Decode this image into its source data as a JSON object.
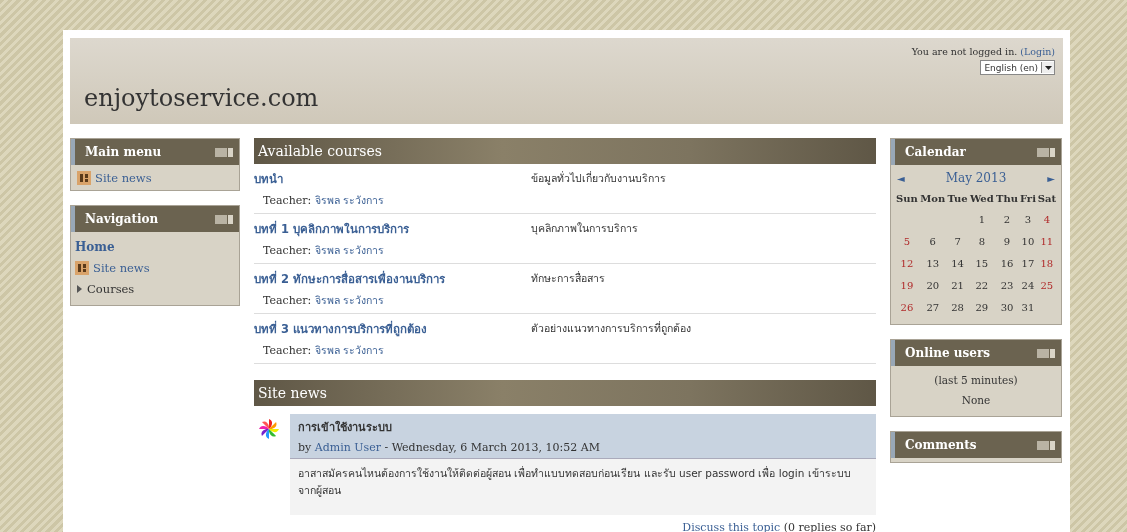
{
  "header": {
    "site_name": "enjoytoservice.com",
    "login_info": "You are not logged in.",
    "login_link": "(Login)",
    "language": "English (en)"
  },
  "main_menu": {
    "title": "Main menu",
    "items": [
      {
        "label": "Site news",
        "kind": "news"
      }
    ]
  },
  "navigation": {
    "title": "Navigation",
    "items": [
      {
        "label": "Home",
        "kind": "home"
      },
      {
        "label": "Site news",
        "kind": "news"
      },
      {
        "label": "Courses",
        "kind": "branch",
        "expanded": false
      }
    ]
  },
  "available_courses": {
    "title": "Available courses",
    "courses": [
      {
        "name": "บทนำ",
        "summary": "ข้อมูลทั่วไปเกี่ยวกับงานบริการ",
        "teacher_label": "Teacher:",
        "teacher": "จิรพล ระวังการ"
      },
      {
        "name": "บทที่ 1 บุคลิกภาพในการบริการ",
        "summary": "บุคลิกภาพในการบริการ",
        "teacher_label": "Teacher:",
        "teacher": "จิรพล ระวังการ"
      },
      {
        "name": "บทที่ 2 ทักษะการสื่อสารเพื่องานบริการ",
        "summary": "ทักษะการสื่อสาร",
        "teacher_label": "Teacher:",
        "teacher": "จิรพล ระวังการ"
      },
      {
        "name": "บทที่ 3 แนวทางการบริการที่ถูกต้อง",
        "summary": "ตัวอย่างแนวทางการบริการที่ถูกต้อง",
        "teacher_label": "Teacher:",
        "teacher": "จิรพล ระวังการ"
      }
    ]
  },
  "site_news": {
    "title": "Site news",
    "posts": [
      {
        "subject": "การเข้าใช้งานระบบ",
        "by": "by",
        "author": "Admin User",
        "date": "- Wednesday, 6 March 2013, 10:52 AM",
        "body": "อาสาสมัครคนไหนต้องการใช้งานให้ติดต่อผู้สอน เพื่อทำแบบทดสอบก่อนเรียน และรับ user password เพื่อ login เข้าระบบจากผู้สอน",
        "discuss_link": "Discuss this topic",
        "replies": "(0 replies so far)"
      }
    ]
  },
  "calendar": {
    "title": "Calendar",
    "prev": "◄",
    "month": "May 2013",
    "next": "►",
    "weekdays": [
      "Sun",
      "Mon",
      "Tue",
      "Wed",
      "Thu",
      "Fri",
      "Sat"
    ],
    "weeks": [
      [
        {
          "kind": "empty"
        },
        {
          "kind": "empty"
        },
        {
          "kind": "empty"
        },
        {
          "day": "1",
          "weekend": false
        },
        {
          "day": "2",
          "weekend": false
        },
        {
          "day": "3",
          "weekend": false
        },
        {
          "day": "4",
          "weekend": true
        }
      ],
      [
        {
          "day": "5",
          "weekend": true
        },
        {
          "day": "6",
          "weekend": false
        },
        {
          "day": "7",
          "weekend": false
        },
        {
          "day": "8",
          "weekend": false
        },
        {
          "day": "9",
          "weekend": false
        },
        {
          "day": "10",
          "weekend": false
        },
        {
          "day": "11",
          "weekend": true
        }
      ],
      [
        {
          "day": "12",
          "weekend": true
        },
        {
          "day": "13",
          "weekend": false
        },
        {
          "day": "14",
          "weekend": false
        },
        {
          "day": "15",
          "weekend": false
        },
        {
          "day": "16",
          "weekend": false
        },
        {
          "day": "17",
          "weekend": false
        },
        {
          "day": "18",
          "weekend": true
        }
      ],
      [
        {
          "day": "19",
          "weekend": true
        },
        {
          "day": "20",
          "weekend": false
        },
        {
          "day": "21",
          "weekend": false
        },
        {
          "day": "22",
          "weekend": false
        },
        {
          "day": "23",
          "weekend": false
        },
        {
          "day": "24",
          "weekend": false
        },
        {
          "day": "25",
          "weekend": true
        }
      ],
      [
        {
          "day": "26",
          "weekend": true
        },
        {
          "day": "27",
          "weekend": false
        },
        {
          "day": "28",
          "weekend": false
        },
        {
          "day": "29",
          "weekend": false
        },
        {
          "day": "30",
          "weekend": false
        },
        {
          "day": "31",
          "weekend": false
        },
        {
          "kind": "empty"
        }
      ]
    ]
  },
  "online_users": {
    "title": "Online users",
    "period": "(last 5 minutes)",
    "users": "None"
  },
  "comments": {
    "title": "Comments"
  }
}
